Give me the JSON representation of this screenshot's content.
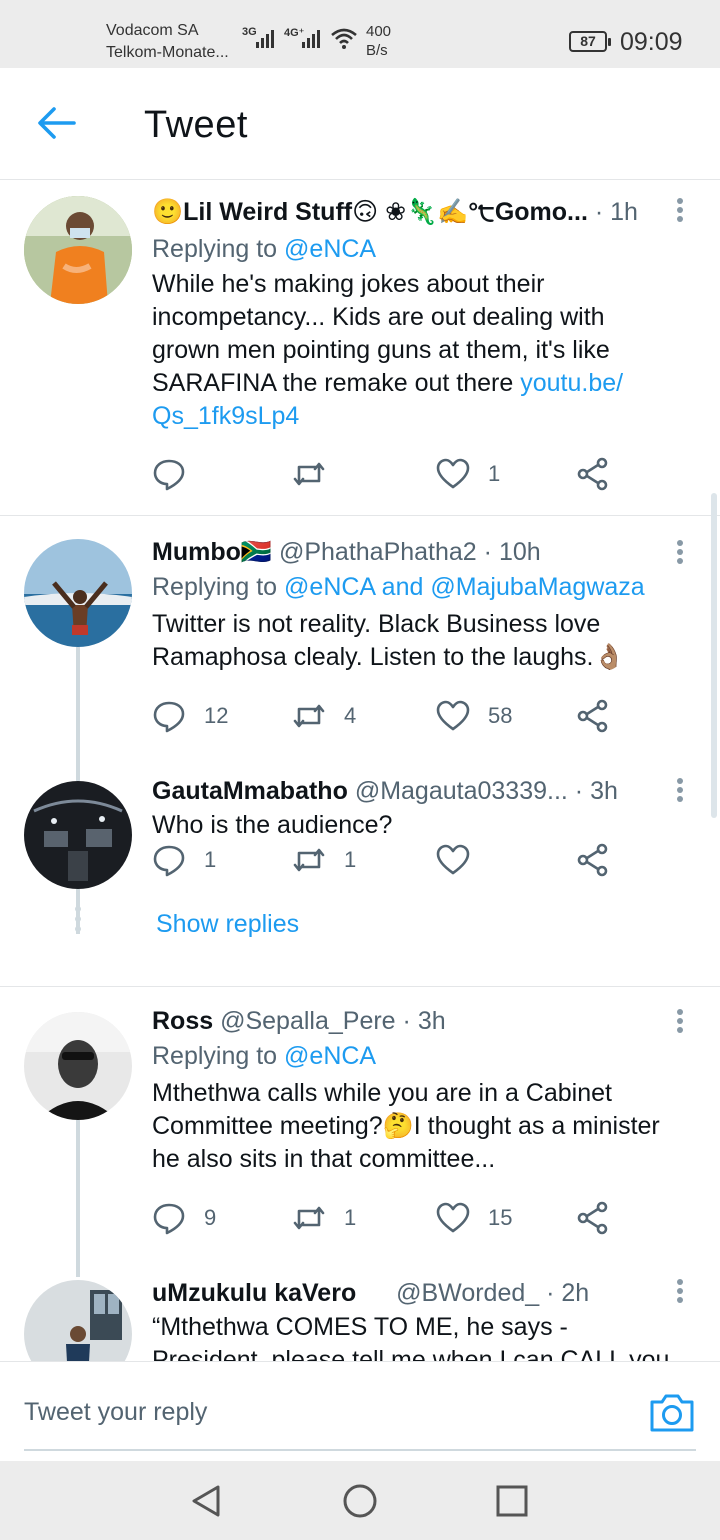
{
  "status_bar": {
    "carrier1": "Vodacom SA",
    "carrier2": "Telkom-Monate...",
    "net1": "3G",
    "net2": "4G⁺",
    "speed_value": "400",
    "speed_unit": "B/s",
    "battery": "87",
    "time": "09:09"
  },
  "header": {
    "title": "Tweet"
  },
  "tweets": [
    {
      "name": "🙂Lil Weird Stuff🙃 ❀🦎✍️°੮Gomo...",
      "handle": "",
      "time": "· 1h",
      "replying_prefix": "Replying to ",
      "replying_to": "@eNCA",
      "text": "While he's making jokes about their incompetancy... Kids are out dealing with grown men pointing guns at them, it's like SARAFINA the remake out there ",
      "link": "youtu.be/​Qs_1fk9sLp4",
      "replies": "",
      "retweets": "",
      "likes": "1"
    },
    {
      "name": "Mumbo🇿🇦",
      "handle": "@PhathaPhatha2",
      "time": "· 10h",
      "replying_prefix": "Replying to ",
      "replying_to": "@eNCA and @MajubaMagwaza",
      "text": "Twitter is not reality. Black Business love Ramaphosa clealy. Listen to the laughs.👌🏽",
      "replies": "12",
      "retweets": "4",
      "likes": "58"
    },
    {
      "name": "GautaMmabatho",
      "handle": "@Magauta03339...",
      "time": "· 3h",
      "text": "Who is the audience?",
      "replies": "1",
      "retweets": "1",
      "likes": "",
      "show_replies": "Show replies"
    },
    {
      "name": "Ross",
      "handle": "@Sepalla_Pere",
      "time": "· 3h",
      "replying_prefix": "Replying to ",
      "replying_to": "@eNCA",
      "text": "Mthethwa calls while you are in a Cabinet Committee meeting?🤔I thought as a minister he also sits in that committee...",
      "replies": "9",
      "retweets": "1",
      "likes": "15"
    },
    {
      "name": "uMzukulu kaVero",
      "handle": "@BWorded_",
      "time": "· 2h",
      "text_line1": "“Mthethwa COMES TO ME, he says -",
      "text_line2": "President, please tell me when I can CALL you"
    }
  ],
  "reply_bar": {
    "placeholder": "Tweet your reply"
  },
  "colors": {
    "accent": "#1d9bf0",
    "muted": "#536471",
    "divider": "#e4e6e8"
  }
}
